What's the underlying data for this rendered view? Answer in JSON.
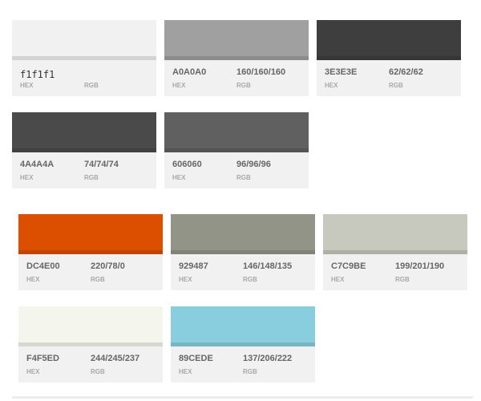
{
  "labels": {
    "hex": "HEX",
    "rgb": "RGB"
  },
  "colors": [
    {
      "hex": "f1f1f1",
      "rgb": "",
      "swatch": "#f1f1f1"
    },
    {
      "hex": "A0A0A0",
      "rgb": "160/160/160",
      "swatch": "#a0a0a0"
    },
    {
      "hex": "3E3E3E",
      "rgb": "62/62/62",
      "swatch": "#3e3e3e"
    },
    {
      "hex": "4A4A4A",
      "rgb": "74/74/74",
      "swatch": "#4a4a4a"
    },
    {
      "hex": "606060",
      "rgb": "96/96/96",
      "swatch": "#606060"
    },
    {
      "hex": "DC4E00",
      "rgb": "220/78/0",
      "swatch": "#dc4e00"
    },
    {
      "hex": "929487",
      "rgb": "146/148/135",
      "swatch": "#929487"
    },
    {
      "hex": "C7C9BE",
      "rgb": "199/201/190",
      "swatch": "#c7c9be"
    },
    {
      "hex": "F4F5ED",
      "rgb": "244/245/237",
      "swatch": "#f4f5ed"
    },
    {
      "hex": "89CEDE",
      "rgb": "137/206/222",
      "swatch": "#89cede"
    }
  ]
}
